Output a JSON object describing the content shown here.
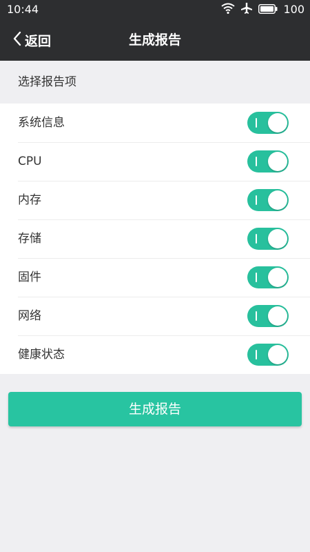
{
  "status_bar": {
    "time": "10:44",
    "battery": "100",
    "icons": [
      "wifi-icon",
      "airplane-icon",
      "battery-icon"
    ]
  },
  "app_bar": {
    "back_label": "返回",
    "title": "生成报告"
  },
  "section": {
    "title": "选择报告项"
  },
  "items": [
    {
      "label": "系统信息",
      "enabled": true
    },
    {
      "label": "CPU",
      "enabled": true
    },
    {
      "label": "内存",
      "enabled": true
    },
    {
      "label": "存储",
      "enabled": true
    },
    {
      "label": "固件",
      "enabled": true
    },
    {
      "label": "网络",
      "enabled": true
    },
    {
      "label": "健康状态",
      "enabled": true
    }
  ],
  "action": {
    "generate_label": "生成报告"
  },
  "colors": {
    "header_bg": "#2d2e30",
    "page_bg": "#efeff2",
    "accent": "#28c09d"
  }
}
